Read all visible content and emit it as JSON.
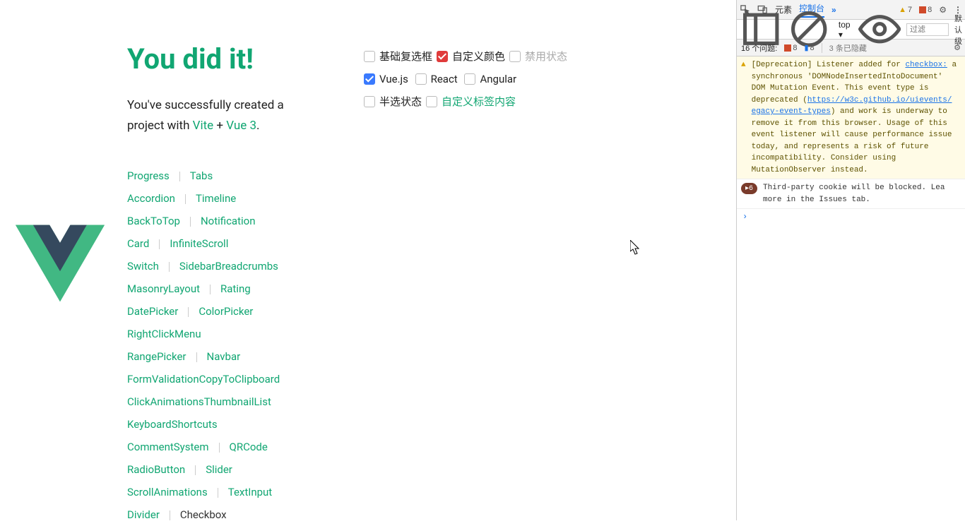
{
  "hero": {
    "title": "You did it!",
    "sub_pre": "You've successfully created a project with ",
    "vite": "Vite",
    "plus": " + ",
    "vue3": "Vue 3",
    "dot": "."
  },
  "nav": [
    "Progress",
    "Tabs",
    "Accordion",
    "Timeline",
    "BackToTop",
    "Notification",
    "Card",
    "InfiniteScroll",
    "Switch",
    "Sidebar",
    "Breadcrumbs",
    "MasonryLayout",
    "Rating",
    "DatePicker",
    "ColorPicker",
    "RightClickMenu",
    "RangePicker",
    "Navbar",
    "FormValidation",
    "CopyToClipboard",
    "ClickAnimations",
    "ThumbnailList",
    "KeyboardShortcuts",
    "CommentSystem",
    "QRCode",
    "RadioButton",
    "Slider",
    "ScrollAnimations",
    "TextInput",
    "Divider",
    "Checkbox"
  ],
  "nav_active": "Checkbox",
  "nav_rows": [
    [
      "Progress",
      "Tabs"
    ],
    [
      "Accordion",
      "Timeline"
    ],
    [
      "BackToTop",
      "Notification"
    ],
    [
      "Card",
      "InfiniteScroll"
    ],
    [
      "Switch",
      "Sidebar"
    ],
    [
      "Breadcrumbs"
    ],
    [
      "MasonryLayout",
      "Rating"
    ],
    [
      "DatePicker",
      "ColorPicker"
    ],
    [
      "RightClickMenu"
    ],
    [
      "RangePicker",
      "Navbar"
    ],
    [
      "FormValidation"
    ],
    [
      "CopyToClipboard"
    ],
    [
      "ClickAnimations"
    ],
    [
      "ThumbnailList"
    ],
    [
      "KeyboardShortcuts"
    ],
    [
      "CommentSystem",
      "QRCode"
    ],
    [
      "RadioButton",
      "Slider"
    ],
    [
      "ScrollAnimations",
      "TextInput"
    ],
    [
      "Divider",
      "Checkbox"
    ]
  ],
  "checkbox": {
    "basic_label": "基础复选框",
    "custom_color_label": "自定义颜色",
    "disabled_label": "禁用状态",
    "vue_label": "Vue.js",
    "react_label": "React",
    "angular_label": "Angular",
    "half_label": "半选状态",
    "custom_tag_label": "自定义标签内容"
  },
  "devtools": {
    "tabs": {
      "elements": "元素",
      "console": "控制台"
    },
    "warnings": "7",
    "errors": "8",
    "filter_placeholder": "过滤",
    "level_label": "默认级",
    "context_top": "top",
    "issues_label": "16 个问题:",
    "issue_err_count": "8",
    "issue_chat_count": "8",
    "hidden_label": "3 条已隐藏",
    "dep_link1": "checkbox:",
    "dep_text_pre": "[Deprecation] Listener added for ",
    "dep_text_body1": "a synchronous 'DOMNodeInsertedIntoDocument' DOM Mutation Event. This event type is deprecated (",
    "dep_link2": "https://w3c.github.io/uievents/",
    "dep_link3": "egacy-event-types",
    "dep_text_body2": ") and work is underway to remove it from this browser. Usage of this event listener will cause performance issue today, and represents a risk of future incompatibility. Consider using MutationObserver instead.",
    "cookie_count": "6",
    "cookie_msg": "Third-party cookie will be blocked. Lea more in the Issues tab."
  }
}
